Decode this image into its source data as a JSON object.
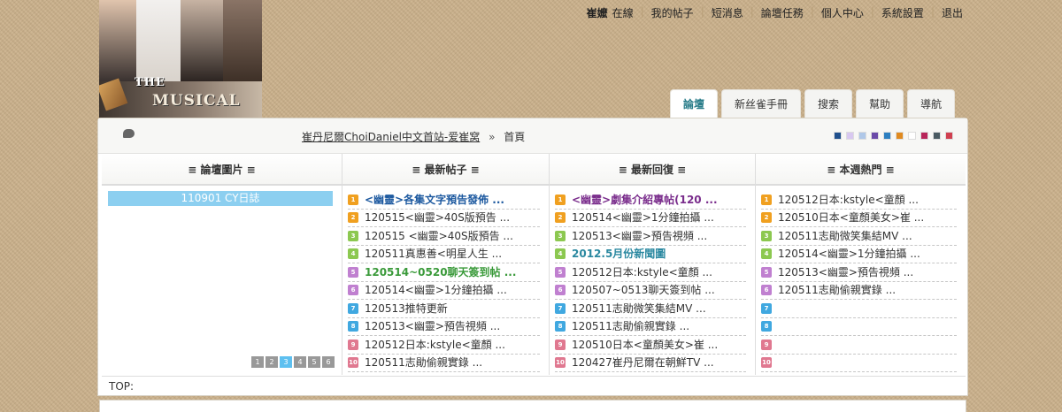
{
  "topnav": {
    "user": "崔嬤",
    "status": "在線",
    "items": [
      "我的帖子",
      "短消息",
      "論壇任務",
      "個人中心",
      "系統設置",
      "退出"
    ]
  },
  "banner": {
    "logo_the": "THE",
    "logo_main": "MUSICAL"
  },
  "tabs": [
    {
      "label": "論壇",
      "active": true
    },
    {
      "label": "新丝雀手冊",
      "active": false
    },
    {
      "label": "搜索",
      "active": false
    },
    {
      "label": "幫助",
      "active": false
    },
    {
      "label": "導航",
      "active": false
    }
  ],
  "breadcrumb": {
    "site": "崔丹尼爾ChoiDaniel中文首站-爱崔窝",
    "arrow": "»",
    "current": "首頁"
  },
  "swatches": [
    "#1f4f8c",
    "#d8c8f0",
    "#b0c8e8",
    "#6a4aa8",
    "#2d7fc0",
    "#e08a20",
    "#ffffff",
    "#b8255a",
    "#4a5a62",
    "#d04050"
  ],
  "columns": {
    "pictures": {
      "title": "≡ 論壇圖片 ≡",
      "caption": "110901 CY日誌",
      "pages": [
        "1",
        "2",
        "3",
        "4",
        "5",
        "6"
      ],
      "current_page": 3
    },
    "latest_posts": {
      "title": "≡ 最新帖子 ≡",
      "items": [
        {
          "text": "<幽靈>各集文字預告發佈 ...",
          "style": "blue"
        },
        {
          "text": "120515<幽靈>40S版預告 ...",
          "style": ""
        },
        {
          "text": "120515 <幽靈>40S版預告 ...",
          "style": ""
        },
        {
          "text": "120511真惠善<明星人生 ...",
          "style": ""
        },
        {
          "text": "120514~0520聊天簽到帖 ...",
          "style": "green"
        },
        {
          "text": "120514<幽靈>1分鐘拍攝 ...",
          "style": ""
        },
        {
          "text": "120513推特更新",
          "style": ""
        },
        {
          "text": "120513<幽靈>預告視頻 ...",
          "style": ""
        },
        {
          "text": "120512日本:kstyle<童顏 ...",
          "style": ""
        },
        {
          "text": "120511志勛偷親實錄 ...",
          "style": ""
        }
      ]
    },
    "latest_replies": {
      "title": "≡ 最新回復 ≡",
      "items": [
        {
          "text": "<幽靈>劇集介紹專帖(120 ...",
          "style": "purple"
        },
        {
          "text": "120514<幽靈>1分鐘拍攝 ...",
          "style": ""
        },
        {
          "text": "120513<幽靈>預告視頻 ...",
          "style": ""
        },
        {
          "text": "2012.5月份新聞圖",
          "style": "teal"
        },
        {
          "text": "120512日本:kstyle<童顏 ...",
          "style": ""
        },
        {
          "text": "120507~0513聊天簽到帖 ...",
          "style": ""
        },
        {
          "text": "120511志勛微笑集結MV ...",
          "style": ""
        },
        {
          "text": "120511志勛偷親實錄 ...",
          "style": ""
        },
        {
          "text": "120510日本<童顏美女>崔 ...",
          "style": ""
        },
        {
          "text": "120427崔丹尼爾在朝鮮TV ...",
          "style": ""
        }
      ]
    },
    "weekly_hot": {
      "title": "≡ 本週熱門 ≡",
      "items": [
        {
          "text": "120512日本:kstyle<童顏 ...",
          "style": ""
        },
        {
          "text": "120510日本<童顏美女>崔 ...",
          "style": ""
        },
        {
          "text": "120511志勛微笑集結MV ...",
          "style": ""
        },
        {
          "text": "120514<幽靈>1分鐘拍攝 ...",
          "style": ""
        },
        {
          "text": "120513<幽靈>預告視頻 ...",
          "style": ""
        },
        {
          "text": "120511志勛偷親實錄 ...",
          "style": ""
        },
        {
          "text": "",
          "style": ""
        },
        {
          "text": "",
          "style": ""
        },
        {
          "text": "",
          "style": ""
        },
        {
          "text": "",
          "style": ""
        }
      ]
    }
  },
  "footer": {
    "top_label": "TOP:"
  }
}
